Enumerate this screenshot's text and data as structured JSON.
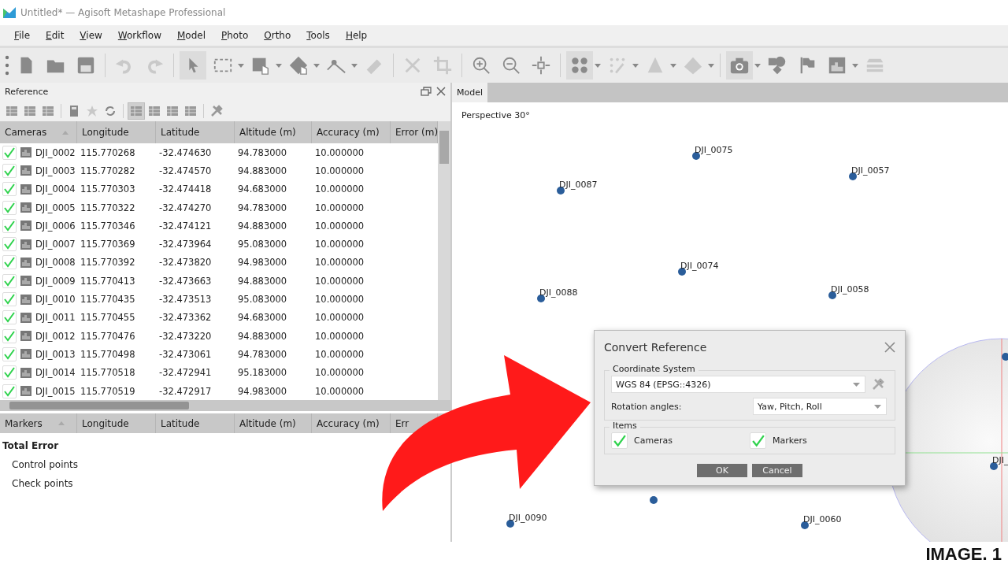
{
  "window": {
    "title": "Untitled* — Agisoft Metashape Professional"
  },
  "menu": [
    "File",
    "Edit",
    "View",
    "Workflow",
    "Model",
    "Photo",
    "Ortho",
    "Tools",
    "Help"
  ],
  "toolbar": [
    {
      "kind": "new",
      "selected": false,
      "disabled": false,
      "dropdown": false
    },
    {
      "kind": "open",
      "selected": false,
      "disabled": false,
      "dropdown": false
    },
    {
      "kind": "save",
      "selected": false,
      "disabled": false,
      "dropdown": false
    },
    {
      "kind": "sep"
    },
    {
      "kind": "undo",
      "selected": false,
      "disabled": true,
      "dropdown": false
    },
    {
      "kind": "redo",
      "selected": false,
      "disabled": true,
      "dropdown": false
    },
    {
      "kind": "sep"
    },
    {
      "kind": "pointer",
      "selected": true,
      "disabled": false,
      "dropdown": false
    },
    {
      "kind": "rect-select",
      "selected": false,
      "disabled": false,
      "dropdown": true
    },
    {
      "kind": "paint-select",
      "selected": false,
      "disabled": false,
      "dropdown": true
    },
    {
      "kind": "shape-select",
      "selected": false,
      "disabled": false,
      "dropdown": true
    },
    {
      "kind": "measure",
      "selected": false,
      "disabled": false,
      "dropdown": true
    },
    {
      "kind": "ruler",
      "selected": false,
      "disabled": true,
      "dropdown": false
    },
    {
      "kind": "sep"
    },
    {
      "kind": "delete",
      "selected": false,
      "disabled": true,
      "dropdown": false
    },
    {
      "kind": "crop",
      "selected": false,
      "disabled": true,
      "dropdown": false
    },
    {
      "kind": "sep"
    },
    {
      "kind": "zoom-in",
      "selected": false,
      "disabled": false,
      "dropdown": false
    },
    {
      "kind": "zoom-out",
      "selected": false,
      "disabled": false,
      "dropdown": false
    },
    {
      "kind": "fit",
      "selected": false,
      "disabled": false,
      "dropdown": false
    },
    {
      "kind": "sep"
    },
    {
      "kind": "points",
      "selected": true,
      "disabled": false,
      "dropdown": true
    },
    {
      "kind": "dense",
      "selected": false,
      "disabled": true,
      "dropdown": true
    },
    {
      "kind": "mesh",
      "selected": false,
      "disabled": true,
      "dropdown": true
    },
    {
      "kind": "tiled",
      "selected": false,
      "disabled": true,
      "dropdown": true
    },
    {
      "kind": "sep"
    },
    {
      "kind": "camera",
      "selected": true,
      "disabled": false,
      "dropdown": true
    },
    {
      "kind": "shapes",
      "selected": false,
      "disabled": false,
      "dropdown": false
    },
    {
      "kind": "flag",
      "selected": false,
      "disabled": false,
      "dropdown": false
    },
    {
      "kind": "image",
      "selected": false,
      "disabled": false,
      "dropdown": true
    },
    {
      "kind": "layers",
      "selected": false,
      "disabled": true,
      "dropdown": false
    }
  ],
  "reference_panel": {
    "title": "Reference",
    "tools": [
      {
        "kind": "import",
        "selected": false
      },
      {
        "kind": "export",
        "selected": false
      },
      {
        "kind": "camera",
        "selected": false
      },
      {
        "kind": "sep"
      },
      {
        "kind": "calc",
        "selected": false
      },
      {
        "kind": "star",
        "selected": false
      },
      {
        "kind": "refresh",
        "selected": false
      },
      {
        "kind": "sep"
      },
      {
        "kind": "grid",
        "selected": true
      },
      {
        "kind": "grid",
        "selected": false
      },
      {
        "kind": "grid",
        "selected": false
      },
      {
        "kind": "grid",
        "selected": false
      },
      {
        "kind": "sep"
      },
      {
        "kind": "settings",
        "selected": false
      }
    ],
    "cameras_table": {
      "columns": [
        "Cameras",
        "Longitude",
        "Latitude",
        "Altitude (m)",
        "Accuracy (m)",
        "Error (m)"
      ],
      "rows": [
        {
          "checked": true,
          "name": "DJI_0002",
          "longitude": "115.770268",
          "latitude": "-32.474630",
          "altitude": "94.783000",
          "accuracy": "10.000000"
        },
        {
          "checked": true,
          "name": "DJI_0003",
          "longitude": "115.770282",
          "latitude": "-32.474570",
          "altitude": "94.883000",
          "accuracy": "10.000000"
        },
        {
          "checked": true,
          "name": "DJI_0004",
          "longitude": "115.770303",
          "latitude": "-32.474418",
          "altitude": "94.683000",
          "accuracy": "10.000000"
        },
        {
          "checked": true,
          "name": "DJI_0005",
          "longitude": "115.770322",
          "latitude": "-32.474270",
          "altitude": "94.783000",
          "accuracy": "10.000000"
        },
        {
          "checked": true,
          "name": "DJI_0006",
          "longitude": "115.770346",
          "latitude": "-32.474121",
          "altitude": "94.883000",
          "accuracy": "10.000000"
        },
        {
          "checked": true,
          "name": "DJI_0007",
          "longitude": "115.770369",
          "latitude": "-32.473964",
          "altitude": "95.083000",
          "accuracy": "10.000000"
        },
        {
          "checked": true,
          "name": "DJI_0008",
          "longitude": "115.770392",
          "latitude": "-32.473820",
          "altitude": "94.983000",
          "accuracy": "10.000000"
        },
        {
          "checked": true,
          "name": "DJI_0009",
          "longitude": "115.770413",
          "latitude": "-32.473663",
          "altitude": "94.883000",
          "accuracy": "10.000000"
        },
        {
          "checked": true,
          "name": "DJI_0010",
          "longitude": "115.770435",
          "latitude": "-32.473513",
          "altitude": "95.083000",
          "accuracy": "10.000000"
        },
        {
          "checked": true,
          "name": "DJI_0011",
          "longitude": "115.770455",
          "latitude": "-32.473362",
          "altitude": "94.683000",
          "accuracy": "10.000000"
        },
        {
          "checked": true,
          "name": "DJI_0012",
          "longitude": "115.770476",
          "latitude": "-32.473220",
          "altitude": "94.883000",
          "accuracy": "10.000000"
        },
        {
          "checked": true,
          "name": "DJI_0013",
          "longitude": "115.770498",
          "latitude": "-32.473061",
          "altitude": "94.783000",
          "accuracy": "10.000000"
        },
        {
          "checked": true,
          "name": "DJI_0014",
          "longitude": "115.770518",
          "latitude": "-32.472941",
          "altitude": "95.183000",
          "accuracy": "10.000000"
        },
        {
          "checked": true,
          "name": "DJI_0015",
          "longitude": "115.770519",
          "latitude": "-32.472917",
          "altitude": "94.983000",
          "accuracy": "10.000000"
        }
      ]
    },
    "markers_table": {
      "columns": [
        "Markers",
        "Longitude",
        "Latitude",
        "Altitude (m)",
        "Accuracy (m)",
        "Err"
      ],
      "rows": [
        {
          "label": "Total Error",
          "bold": true
        },
        {
          "label": "Control points",
          "bold": false
        },
        {
          "label": "Check points",
          "bold": false
        }
      ]
    }
  },
  "model_view": {
    "tab": "Model",
    "projection": "Perspective 30°",
    "cameras": [
      "DJI_0075",
      "DJI_0057",
      "DJI_0087",
      "DJI_0074",
      "DJI_0088",
      "DJI_0058",
      "DJI_0090",
      "DJI_0060",
      "DJI_"
    ]
  },
  "dialog": {
    "title": "Convert Reference",
    "coordinate_group": "Coordinate System",
    "coordinate_system": "WGS 84 (EPSG::4326)",
    "rotation_label": "Rotation angles:",
    "rotation_value": "Yaw, Pitch, Roll",
    "items_group": "Items",
    "items": [
      {
        "label": "Cameras",
        "checked": true
      },
      {
        "label": "Markers",
        "checked": true
      }
    ],
    "buttons": [
      "OK",
      "Cancel"
    ]
  },
  "caption": "IMAGE. 1"
}
